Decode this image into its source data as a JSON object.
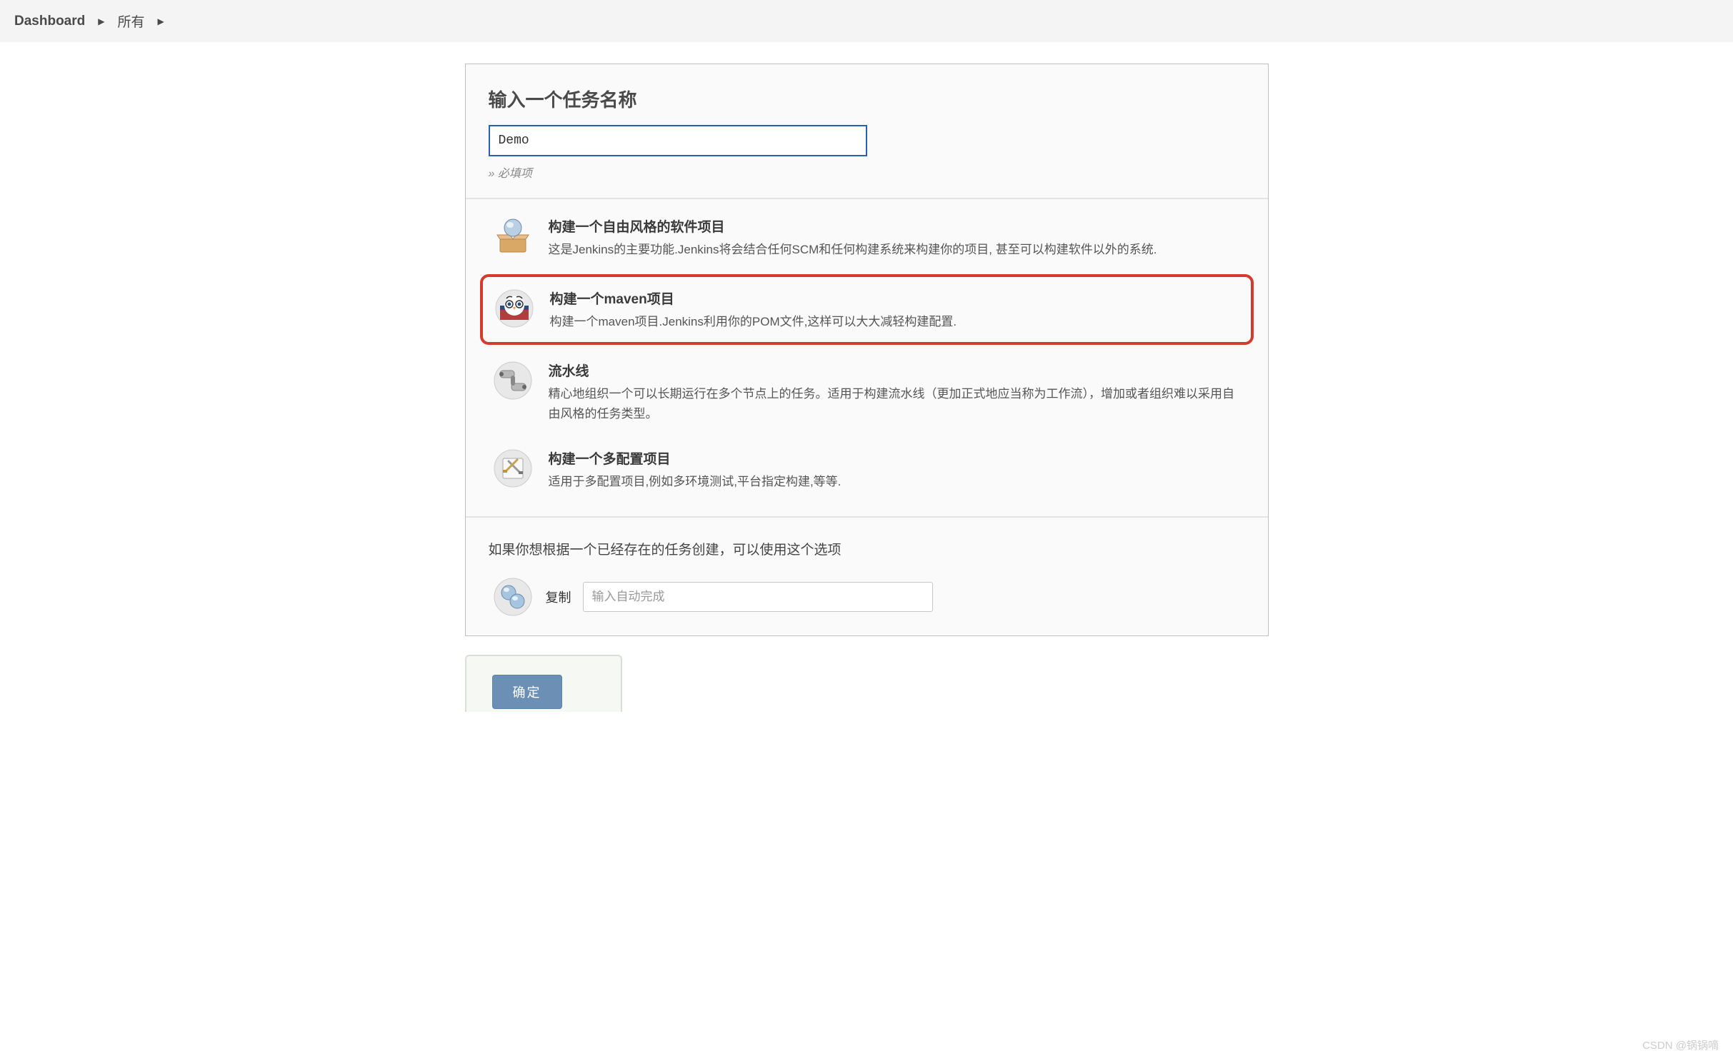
{
  "breadcrumbs": {
    "root": "Dashboard",
    "all": "所有"
  },
  "header": {
    "title": "输入一个任务名称",
    "name_value": "Demo",
    "required_hint": "» 必填项"
  },
  "options": [
    {
      "title": "构建一个自由风格的软件项目",
      "desc": "这是Jenkins的主要功能.Jenkins将会结合任何SCM和任何构建系统来构建你的项目, 甚至可以构建软件以外的系统.",
      "selected": false,
      "icon": "freestyle"
    },
    {
      "title": "构建一个maven项目",
      "desc": "构建一个maven项目.Jenkins利用你的POM文件,这样可以大大减轻构建配置.",
      "selected": true,
      "icon": "maven"
    },
    {
      "title": "流水线",
      "desc": "精心地组织一个可以长期运行在多个节点上的任务。适用于构建流水线（更加正式地应当称为工作流），增加或者组织难以采用自由风格的任务类型。",
      "selected": false,
      "icon": "pipeline"
    },
    {
      "title": "构建一个多配置项目",
      "desc": "适用于多配置项目,例如多环境测试,平台指定构建,等等.",
      "selected": false,
      "icon": "multiconfig"
    }
  ],
  "copy": {
    "hint": "如果你想根据一个已经存在的任务创建，可以使用这个选项",
    "label": "复制",
    "placeholder": "输入自动完成",
    "icon": "copy"
  },
  "footer": {
    "ok": "确定"
  },
  "watermark": "CSDN @锅锅嘀"
}
